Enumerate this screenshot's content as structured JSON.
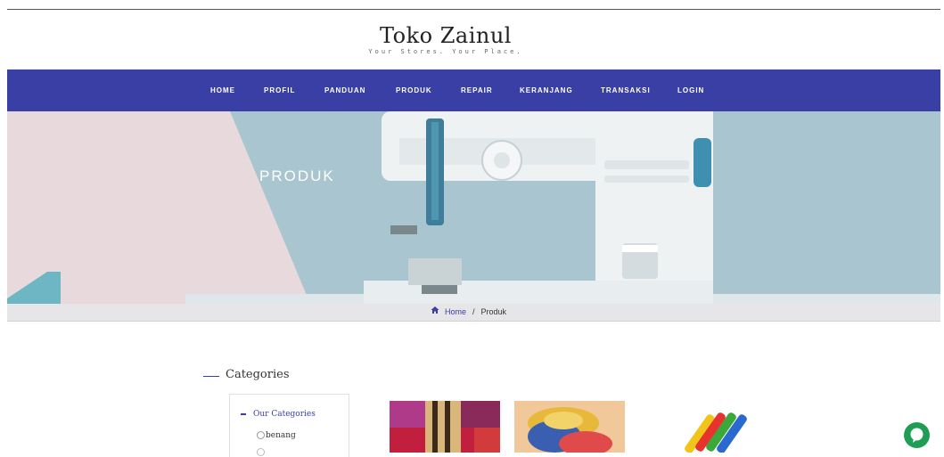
{
  "brand": {
    "title": "Toko Zainul",
    "tagline": "Your Stores. Your Place."
  },
  "nav": {
    "items": [
      "HOME",
      "PROFIL",
      "PANDUAN",
      "PRODUK",
      "REPAIR",
      "KERANJANG",
      "TRANSAKSI",
      "LOGIN"
    ]
  },
  "hero": {
    "title": "PRODUK"
  },
  "breadcrumb": {
    "home_icon": "home-icon",
    "home": "Home",
    "separator": "/",
    "current": "Produk"
  },
  "categories": {
    "heading": "Categories",
    "root": "Our Categories",
    "items": [
      "benang"
    ]
  },
  "products": [
    {
      "icon": "thread-spools-image"
    },
    {
      "icon": "pincushion-image"
    },
    {
      "icon": "colored-pencils-image"
    }
  ],
  "chat": {
    "icon": "chat-bubble-icon",
    "color": "#1f9d55"
  },
  "colors": {
    "accent": "#3a3fa5"
  }
}
